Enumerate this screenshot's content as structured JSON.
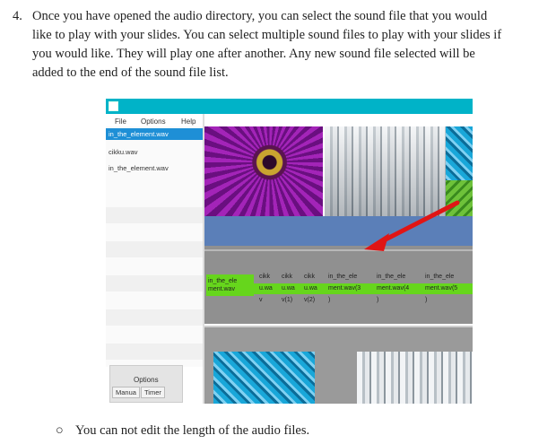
{
  "step": {
    "number": "4.",
    "lines": [
      "Once you have opened the audio directory, you can select the sound file that you would",
      "like to play with your slides. You can select multiple sound files to play with your slides if",
      "you would like. They will play one after another. Any new sound file selected will be",
      "added to the end of the sound file list."
    ]
  },
  "screenshot": {
    "menu": {
      "file": "File",
      "options": "Options",
      "help": "Help"
    },
    "file_list": [
      "in_the_element.wav",
      "cikku.wav",
      "in_the_element.wav"
    ],
    "options_panel": {
      "label": "Options",
      "tab_manual": "Manua",
      "tab_timer": "Timer"
    },
    "timeline": {
      "first_clip": [
        "in_the_ele",
        "ment.wav"
      ],
      "clips_row1": [
        "cikk",
        "cikk",
        "cikk",
        "in_the_ele",
        "in_the_ele",
        "in_the_ele"
      ],
      "clips_row2": [
        "u.wa",
        "u.wa",
        "u.wa",
        "ment.wav(3",
        "ment.wav(4",
        "ment.wav(5"
      ],
      "clips_row3": [
        "v",
        "v(1)",
        "v(2)",
        ")",
        ")",
        ")"
      ]
    },
    "colors": {
      "titlebar": "#00b3c8",
      "selection": "#1e8fd6",
      "clip_green": "#66d61c",
      "arrow": "#e01515"
    },
    "icons": [
      "red-arrow-icon",
      "window-icon"
    ]
  },
  "bullet": {
    "marker": "○",
    "text": "You can not edit the length of the audio files."
  }
}
